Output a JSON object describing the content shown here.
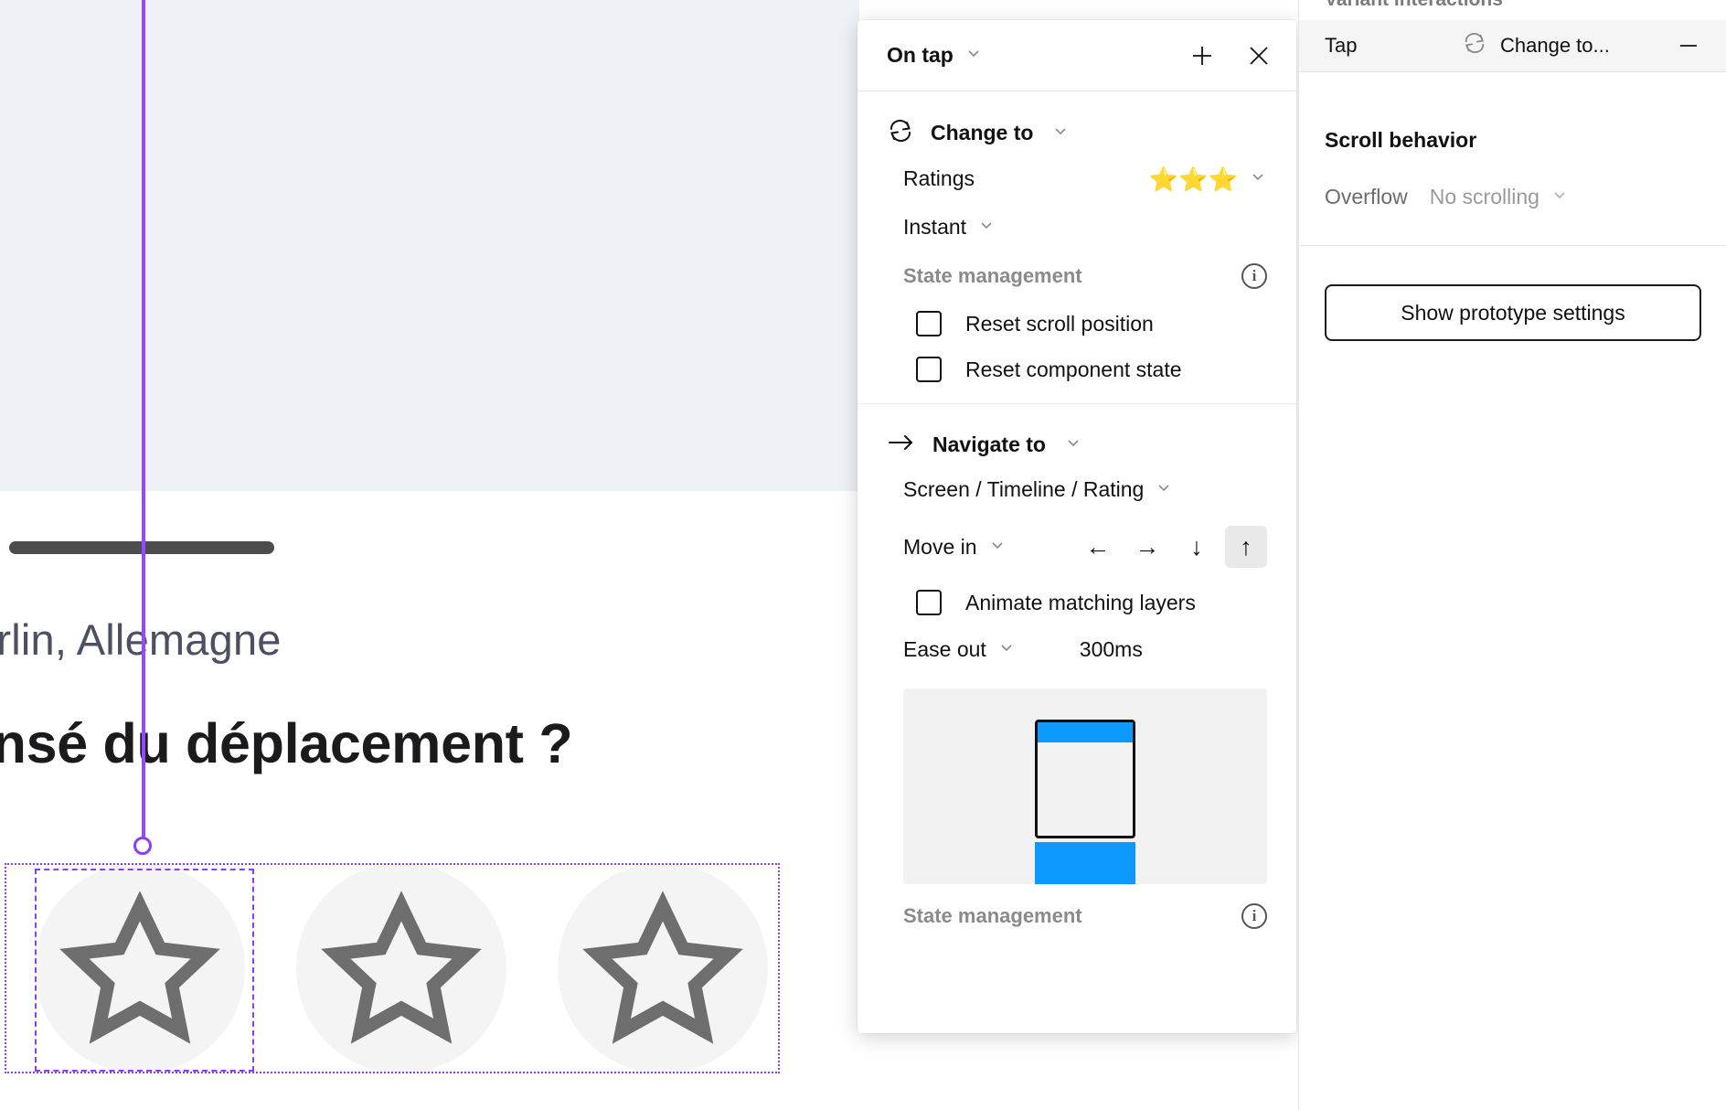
{
  "canvas": {
    "subtitle": "erlin, Allemagne",
    "heading": "ensé du déplacement ?",
    "star_count": 3,
    "star_icon": "star-outline-icon",
    "selection_color": "#8b3dff",
    "connector_color": "#9747ff"
  },
  "popup": {
    "header": {
      "title": "On tap",
      "caret_icon": "chevron-down-icon",
      "add_icon": "plus-icon",
      "close_icon": "close-icon"
    },
    "change_to": {
      "icon": "swap-variant-icon",
      "title": "Change to",
      "caret_icon": "chevron-down-icon",
      "target_label": "Ratings",
      "target_value_stars": "⭐⭐⭐",
      "target_caret_icon": "chevron-down-icon",
      "animation": "Instant",
      "animation_caret_icon": "chevron-down-icon",
      "state_management_title": "State management",
      "state_management_info_icon": "info-icon",
      "checkboxes": [
        {
          "label": "Reset scroll position",
          "checked": false
        },
        {
          "label": "Reset component state",
          "checked": false
        }
      ]
    },
    "navigate_to": {
      "icon": "arrow-right-icon",
      "title": "Navigate to",
      "caret_icon": "chevron-down-icon",
      "destination": "Screen / Timeline / Rating",
      "destination_caret_icon": "chevron-down-icon",
      "animation": "Move in",
      "animation_caret_icon": "chevron-down-icon",
      "directions": [
        {
          "name": "arrow-left-icon",
          "glyph": "←",
          "active": false
        },
        {
          "name": "arrow-right-icon",
          "glyph": "→",
          "active": false
        },
        {
          "name": "arrow-down-icon",
          "glyph": "↓",
          "active": false
        },
        {
          "name": "arrow-up-icon",
          "glyph": "↑",
          "active": true
        }
      ],
      "animate_matching_layers": {
        "label": "Animate matching layers",
        "checked": false
      },
      "easing": "Ease out",
      "easing_caret_icon": "chevron-down-icon",
      "duration": "300ms",
      "preview_accent_color": "#0d99ff",
      "state_management_title": "State management",
      "state_management_info_icon": "info-icon"
    }
  },
  "sidebar": {
    "clipped_title": "Variant interactions",
    "interaction": {
      "trigger": "Tap",
      "action_icon": "swap-variant-icon",
      "action": "Change to...",
      "remove_icon": "minus-icon"
    },
    "scroll_behavior": {
      "title": "Scroll behavior",
      "overflow_label": "Overflow",
      "overflow_value": "No scrolling",
      "overflow_caret_icon": "chevron-down-icon"
    },
    "prototype_button": "Show prototype settings"
  }
}
